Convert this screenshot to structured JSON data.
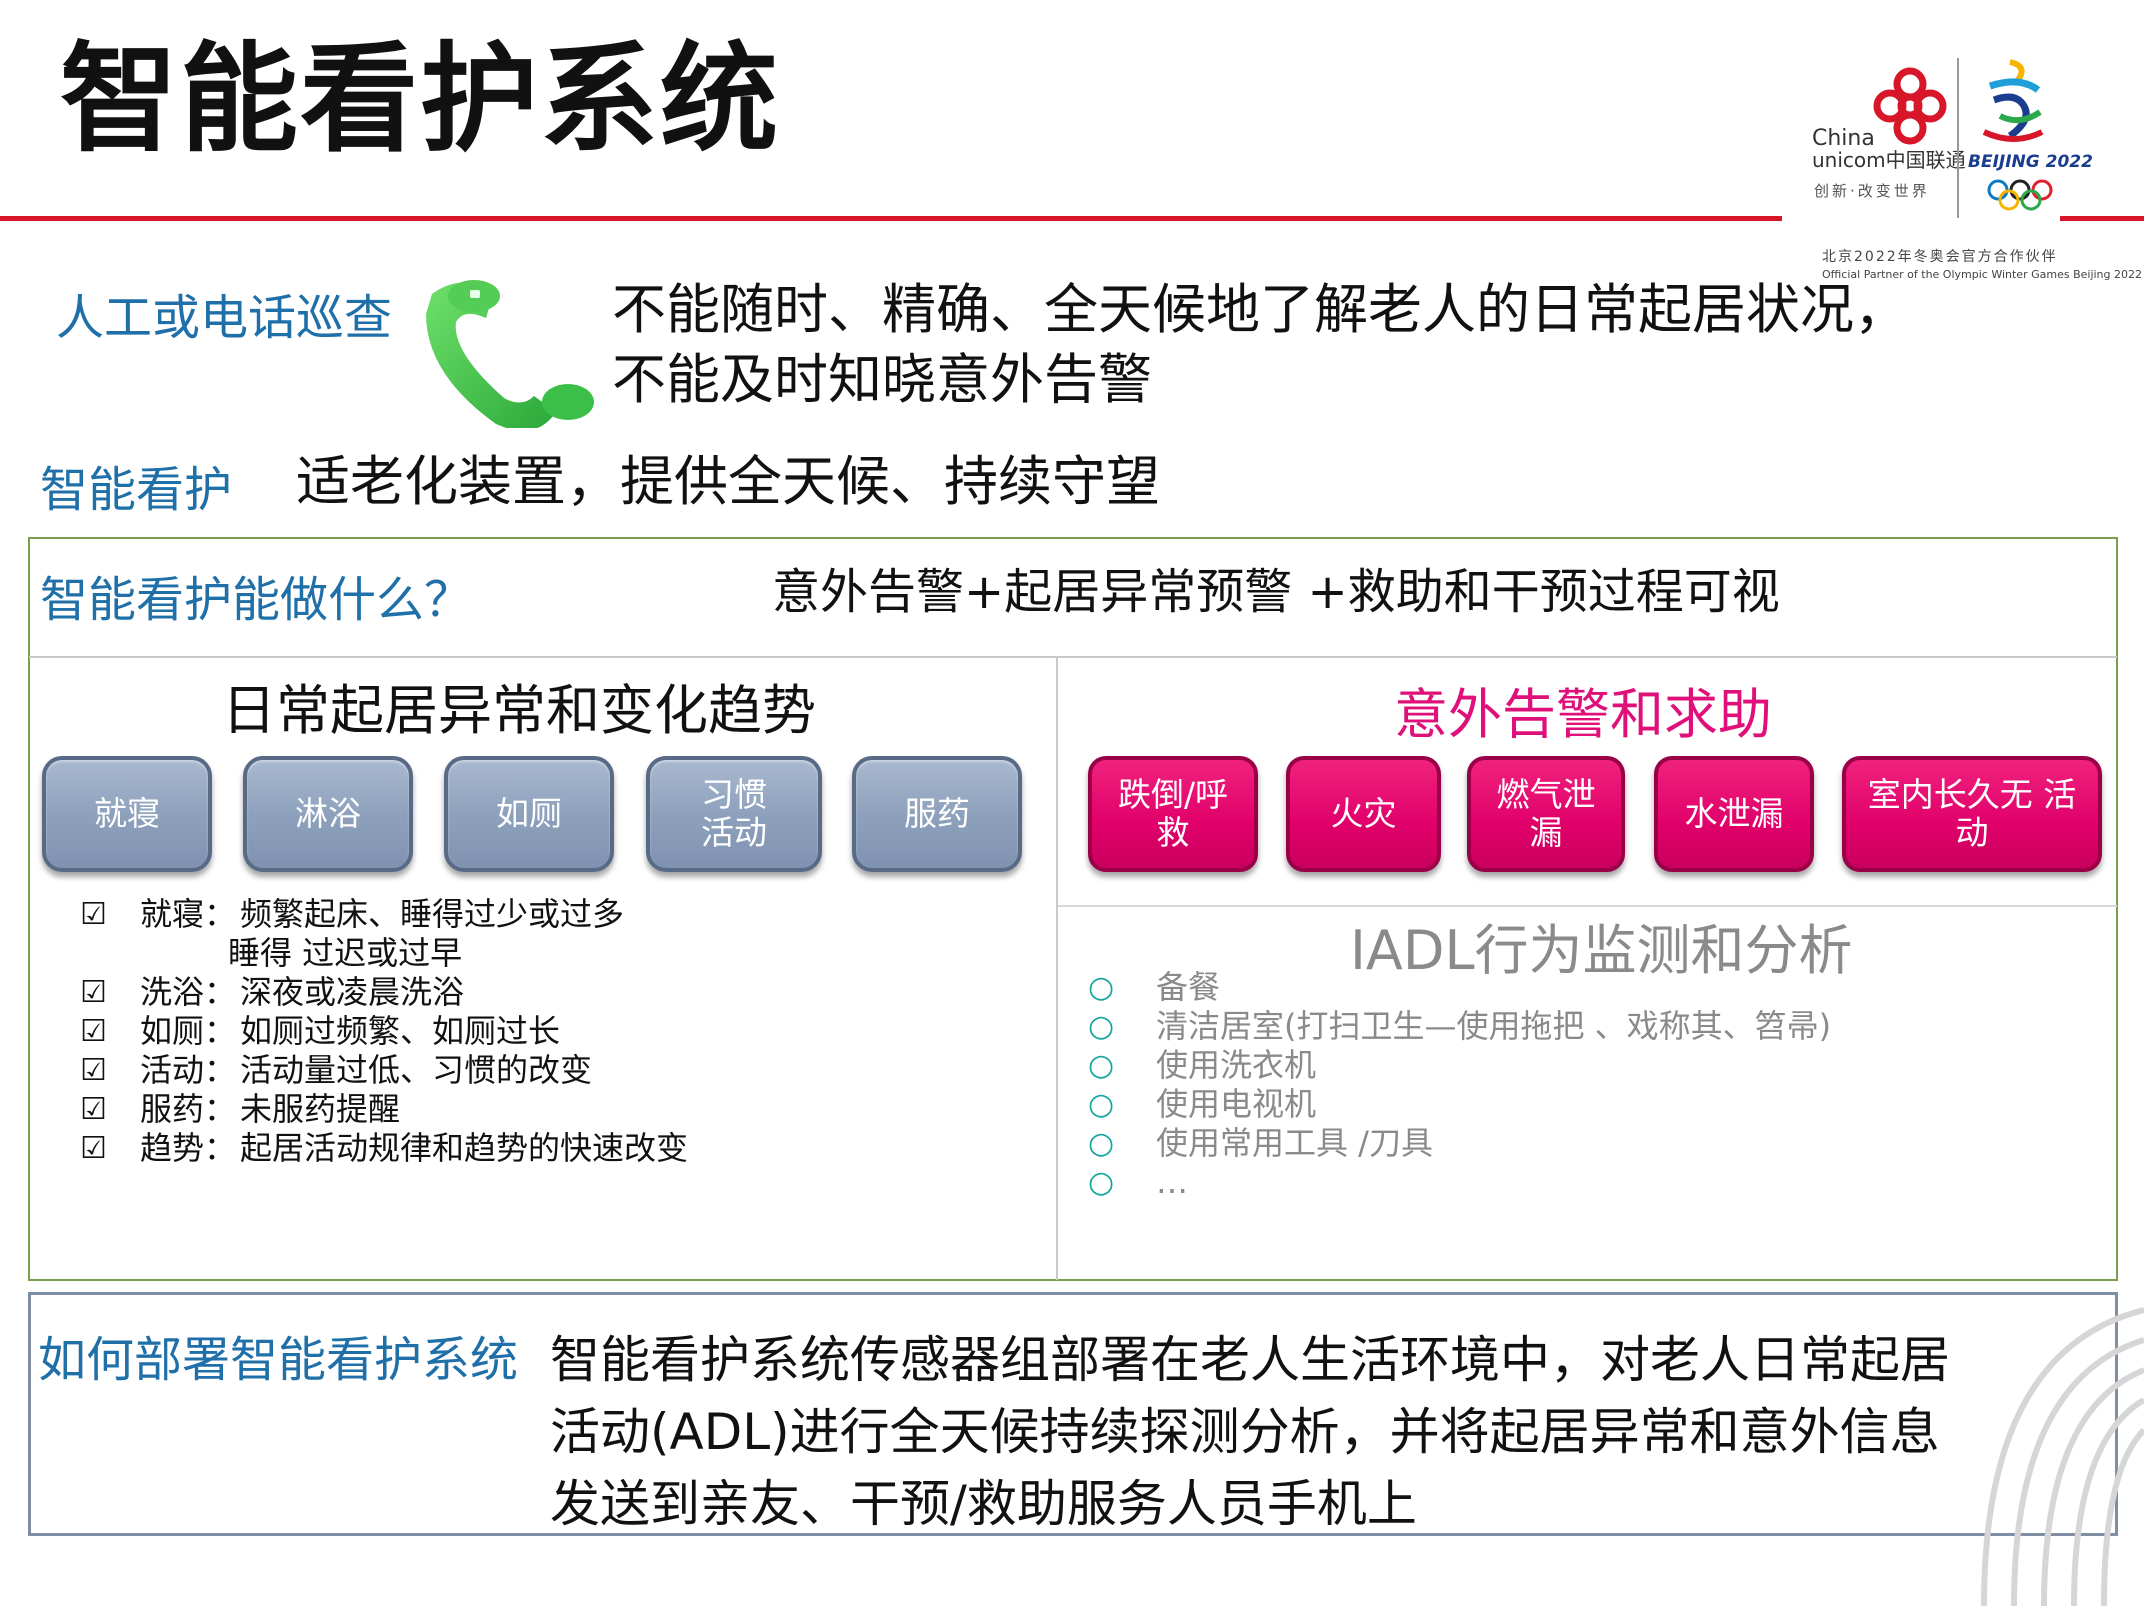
{
  "header": {
    "title": "智能看护系统",
    "logo": {
      "brand_en_1": "China",
      "brand_en_2": "unicom中国联通",
      "slogan": "创新·改变世界",
      "olympic_text": "BEIJING 2022",
      "partner_cn": "北京2022年冬奥会官方合作伙伴",
      "partner_en": "Official Partner of the Olympic Winter Games Beijing 2022"
    }
  },
  "manual": {
    "label": "人工或电话巡查",
    "icon": "phone-handset-icon",
    "line1": "不能随时、精确、全天候地了解老人的日常起居状况，",
    "line2": "不能及时知晓意外告警"
  },
  "smart": {
    "label": "智能看护",
    "text": "适老化装置，提供全天候、持续守望"
  },
  "capability": {
    "question": "智能看护能做什么？",
    "answer": "意外告警+起居异常预警 +救助和干预过程可视"
  },
  "left_panel": {
    "heading": "日常起居异常和变化趋势",
    "buttons": [
      {
        "line1": "就寝",
        "line2": ""
      },
      {
        "line1": "淋浴",
        "line2": ""
      },
      {
        "line1": "如厕",
        "line2": ""
      },
      {
        "line1": "习惯",
        "line2": "活动"
      },
      {
        "line1": "服药",
        "line2": ""
      }
    ],
    "checklist": [
      {
        "mark": "☑",
        "label": "就寝：",
        "text": "频繁起床、睡得过少或过多"
      },
      {
        "mark": "",
        "label": "",
        "text": "睡得 过迟或过早"
      },
      {
        "mark": "☑",
        "label": "洗浴：",
        "text": "深夜或凌晨洗浴"
      },
      {
        "mark": "☑",
        "label": "如厕：",
        "text": "如厕过频繁、如厕过长"
      },
      {
        "mark": "☑",
        "label": "活动：",
        "text": "活动量过低、习惯的改变"
      },
      {
        "mark": "☑",
        "label": "服药：",
        "text": "未服药提醒"
      },
      {
        "mark": "☑",
        "label": "趋势：",
        "text": "起居活动规律和趋势的快速改变"
      }
    ]
  },
  "right_panel": {
    "heading": "意外告警和求助",
    "heading_color": "#e0107a",
    "buttons": [
      {
        "line1": "跌倒/呼",
        "line2": "救"
      },
      {
        "line1": "火灾",
        "line2": ""
      },
      {
        "line1": "燃气泄",
        "line2": "漏"
      },
      {
        "line1": "水泄漏",
        "line2": ""
      },
      {
        "line1": "室内长久无 活",
        "line2": "动"
      }
    ],
    "iadl_heading": "IADL行为监测和分析",
    "iadl_items": [
      "备餐",
      "清洁居室(打扫卫生—使用拖把 、戏称其、笤帚)",
      "使用洗衣机",
      "使用电视机",
      "使用常用工具 /刀具",
      "…"
    ],
    "iadl_bullet": "○"
  },
  "deploy": {
    "label": "如何部署智能看护系统",
    "line1": "智能看护系统传感器组部署在老人生活环境中，对老人日常起居",
    "line2": "活动(ADL)进行全天候持续探测分析，并将起居异常和意外信息",
    "line3": "发送到亲友、干预/救助服务人员手机上"
  },
  "colors": {
    "accent_red": "#d7162a",
    "label_blue": "#1f6fa8",
    "magenta": "#e0006a",
    "steel_blue": "#8ea1bc",
    "box_green": "#7aa04d"
  }
}
